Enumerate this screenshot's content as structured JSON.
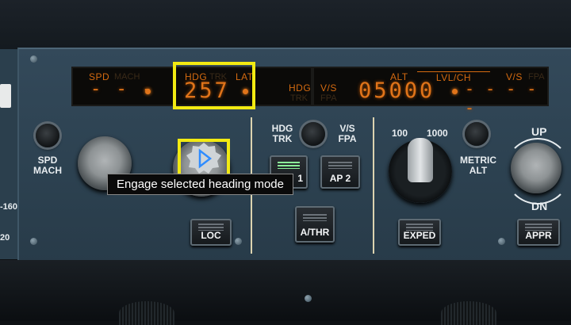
{
  "display": {
    "spd_label": "SPD",
    "mach_label": "MACH",
    "spd_value": "- - -",
    "hdg_label": "HDG",
    "trk_label": "TRK",
    "lat_label": "LAT",
    "hdg_value": "257",
    "hdg_vs_label": "HDG",
    "vs_label": "V/S",
    "trk_dim": "TRK",
    "fpa_dim": "FPA",
    "alt_label": "ALT",
    "lvlch_label": "LVL/CH",
    "vs2_label": "V/S",
    "fpa2_label": "FPA",
    "alt_value": "05000",
    "vs_value": "- - - - -"
  },
  "controls": {
    "spd_mach": "SPD\nMACH",
    "hdg_trk": "HDG\nTRK",
    "vs_fpa": "V/S\nFPA",
    "ap1": "1",
    "ap2": "AP  2",
    "athr": "A/THR",
    "loc": "LOC",
    "exped": "EXPED",
    "appr": "APPR",
    "alt_100": "100",
    "alt_1000": "1000",
    "metric_alt": "METRIC\nALT",
    "up": "UP",
    "dn": "DN"
  },
  "left_edge": {
    "text_160": "-160",
    "text_20": "20"
  },
  "tooltip": "Engage selected heading mode",
  "colors": {
    "display_orange": "#e0741a",
    "highlight_yellow": "#f2ea12",
    "tooltip_icon_blue": "#2f8cff",
    "active_green": "#8cf09a"
  }
}
